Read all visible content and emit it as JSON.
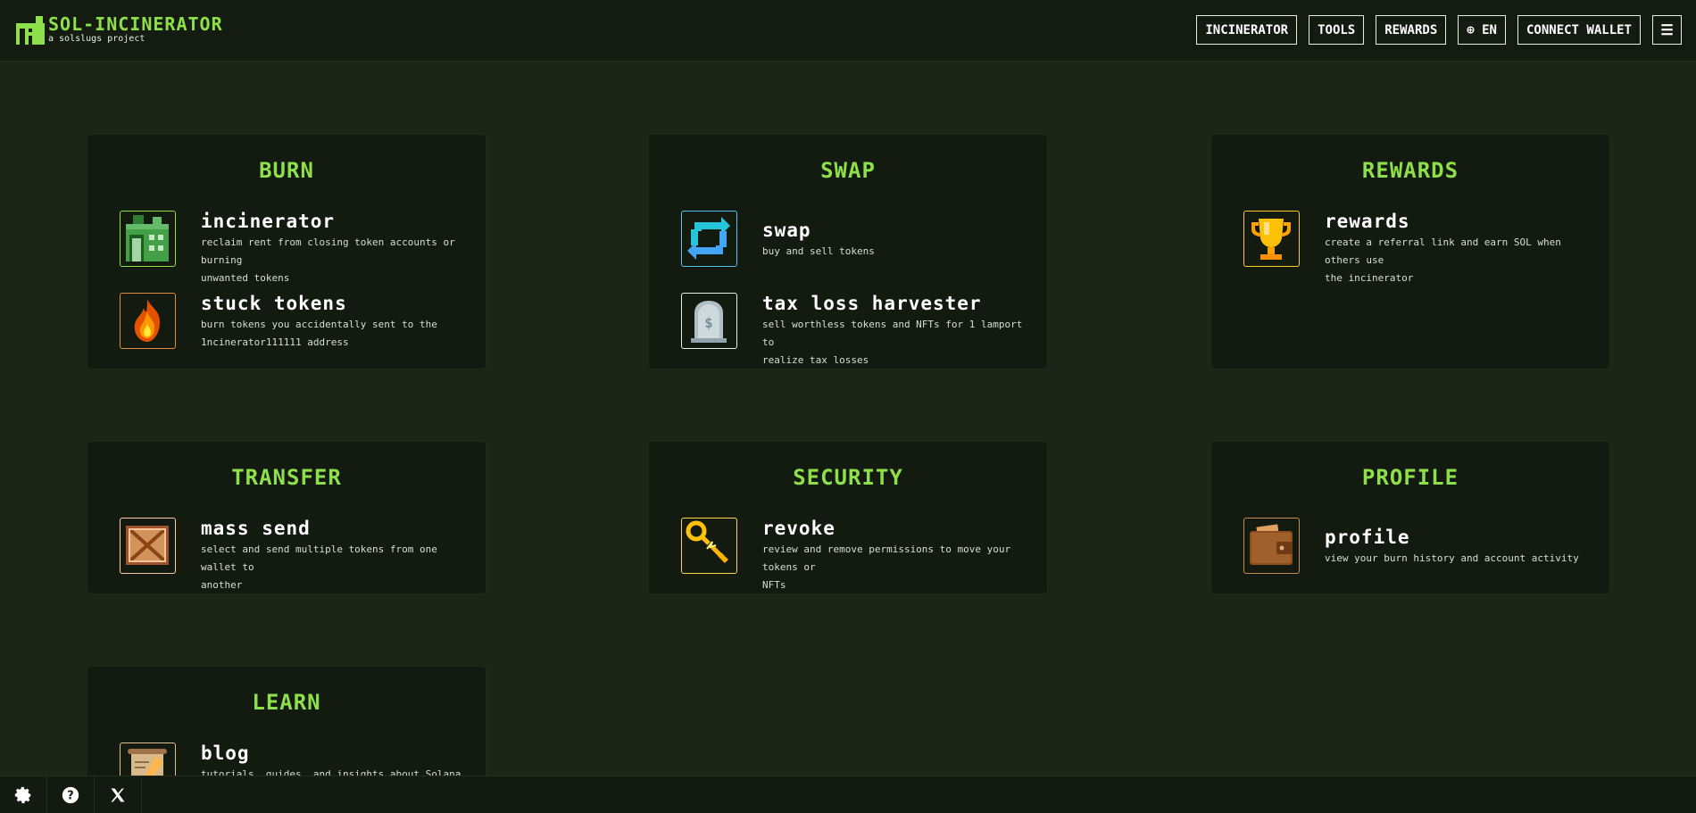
{
  "header": {
    "logo_title": "SOL-INCINERATOR",
    "logo_sub": "a solslugs project",
    "nav": {
      "incinerator": "INCINERATOR",
      "tools": "TOOLS",
      "rewards": "REWARDS",
      "language": "⊕ EN",
      "connect": "CONNECT WALLET",
      "menu": "☰"
    }
  },
  "sections": {
    "burn": {
      "title": "BURN",
      "items": [
        {
          "name": "incinerator",
          "desc1": "reclaim rent from closing token accounts or burning",
          "desc2": "unwanted tokens",
          "icon": "building-icon"
        },
        {
          "name": "stuck tokens",
          "desc1": "burn tokens you accidentally sent to the",
          "desc2": "1ncinerator111111 address",
          "icon": "fire-icon"
        }
      ]
    },
    "swap": {
      "title": "SWAP",
      "items": [
        {
          "name": "swap",
          "desc1": "buy and sell tokens",
          "icon": "swap-arrows-icon"
        },
        {
          "name": "tax loss harvester",
          "desc1": "sell worthless tokens and NFTs for 1 lamport to",
          "desc2": "realize tax losses",
          "icon": "tombstone-icon"
        }
      ]
    },
    "rewards": {
      "title": "REWARDS",
      "items": [
        {
          "name": "rewards",
          "desc1": "create a referral link and earn SOL when others use",
          "desc2": "the incinerator",
          "icon": "trophy-icon"
        }
      ]
    },
    "transfer": {
      "title": "TRANSFER",
      "items": [
        {
          "name": "mass send",
          "desc1": "select and send multiple tokens from one wallet to",
          "desc2": "another",
          "icon": "crate-icon"
        }
      ]
    },
    "security": {
      "title": "SECURITY",
      "items": [
        {
          "name": "revoke",
          "desc1": "review and remove permissions to move your tokens or",
          "desc2": "NFTs",
          "icon": "broken-key-icon"
        }
      ]
    },
    "profile": {
      "title": "PROFILE",
      "items": [
        {
          "name": "profile",
          "desc1": "view your burn history and account activity",
          "icon": "wallet-icon"
        }
      ]
    },
    "learn": {
      "title": "LEARN",
      "items": [
        {
          "name": "blog",
          "desc1": "tutorials, guides, and insights about Solana and",
          "icon": "scroll-icon"
        }
      ]
    }
  },
  "footer": {
    "settings_icon": "gear-icon",
    "help_icon": "help-icon",
    "x_icon": "x-logo-icon"
  },
  "colors": {
    "accent": "#8ee04b",
    "background": "#1b2616",
    "card": "#131a10",
    "header": "#141c11"
  }
}
